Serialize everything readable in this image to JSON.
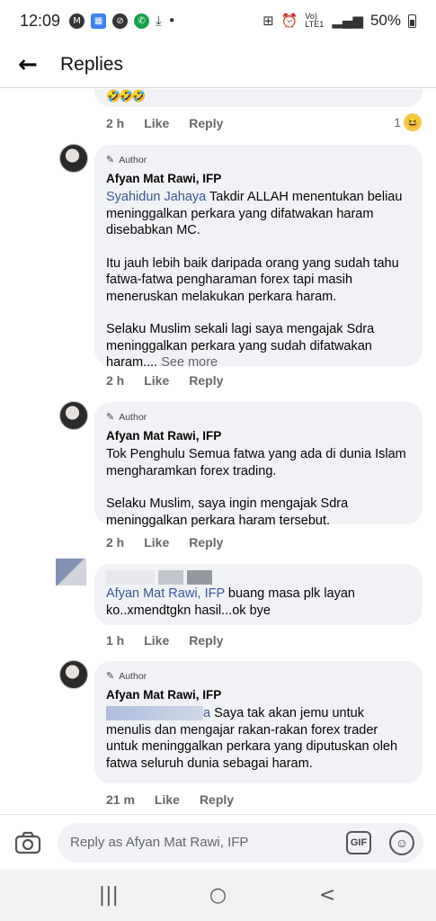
{
  "status_bar": {
    "time": "12:09",
    "battery": "50%",
    "network": "Vo) LTE1"
  },
  "header": {
    "title": "Replies"
  },
  "comments": [
    {
      "time": "2 h",
      "like": "Like",
      "reply": "Reply",
      "reaction_count": "1",
      "emojis": "🤣🤣🤣"
    },
    {
      "author_tag": "Author",
      "name": "Afyan Mat Rawi, IFP",
      "mention": "Syahidun Jahaya",
      "text1": " Takdir ALLAH menentukan beliau meninggalkan perkara yang difatwakan haram disebabkan MC.",
      "text2": "Itu jauh lebih baik daripada orang yang sudah tahu fatwa-fatwa pengharaman forex tapi masih meneruskan melakukan perkara haram.",
      "text3": "Selaku Muslim sekali lagi saya mengajak Sdra meninggalkan perkara yang sudah difatwakan haram....",
      "see_more": "See more",
      "time": "2 h",
      "like": "Like",
      "reply": "Reply"
    },
    {
      "author_tag": "Author",
      "name": "Afyan Mat Rawi, IFP",
      "text1": "Tok Penghulu Semua fatwa yang ada di dunia Islam mengharamkan forex trading.",
      "text2": "Selaku Muslim, saya ingin mengajak Sdra meninggalkan perkara haram tersebut.",
      "time": "2 h",
      "like": "Like",
      "reply": "Reply"
    },
    {
      "mention": "Afyan Mat Rawi, IFP",
      "text1": " buang masa plk layan ko..xmendtgkn hasil...ok bye",
      "time": "1 h",
      "like": "Like",
      "reply": "Reply"
    },
    {
      "author_tag": "Author",
      "name": "Afyan Mat Rawi, IFP",
      "mention_tail": "a",
      "text1": " Saya tak akan jemu untuk menulis dan mengajar rakan-rakan forex trader untuk meninggalkan perkara yang diputuskan oleh fatwa seluruh dunia sebagai haram.",
      "time": "21 m",
      "like": "Like",
      "reply": "Reply"
    }
  ],
  "composer": {
    "placeholder": "Reply as Afyan Mat Rawi, IFP",
    "gif_label": "GIF"
  },
  "nav": {
    "recent": "|||",
    "home": "○",
    "back": "<"
  }
}
